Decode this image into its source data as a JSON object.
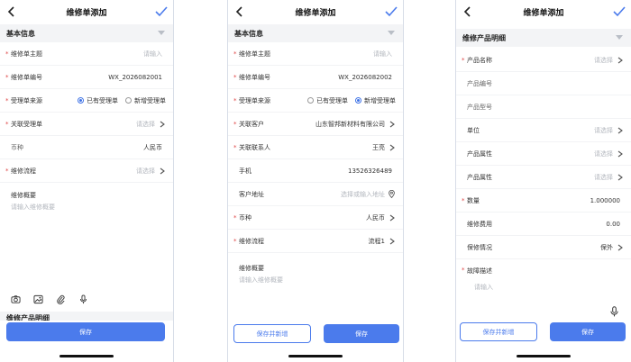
{
  "colors": {
    "primary": "#4b7bec",
    "required": "#e04848",
    "placeholder": "#b3b7be"
  },
  "screen1": {
    "title": "维修单添加",
    "section": "基本信息",
    "rows": {
      "subject": {
        "label": "维修单主题",
        "placeholder": "请输入"
      },
      "number": {
        "label": "维修单编号",
        "value": "WX_2026082001"
      },
      "source": {
        "label": "受理单来源",
        "opt1": "已有受理单",
        "opt2": "新增受理单",
        "selected": "opt1"
      },
      "linked": {
        "label": "关联受理单",
        "placeholder": "请选择"
      },
      "currency": {
        "label": "币种",
        "value": "人民币"
      },
      "flow": {
        "label": "维修流程",
        "placeholder": "请选择"
      }
    },
    "summary": {
      "label": "维修概要",
      "placeholder": "请输入维修概要"
    },
    "next_section": "维修产品明细",
    "save": "保存"
  },
  "screen2": {
    "title": "维修单添加",
    "section": "基本信息",
    "rows": {
      "subject": {
        "label": "维修单主题",
        "placeholder": "请输入"
      },
      "number": {
        "label": "维修单编号",
        "value": "WX_2026082002"
      },
      "source": {
        "label": "受理单来源",
        "opt1": "已有受理单",
        "opt2": "新增受理单",
        "selected": "opt2"
      },
      "customer": {
        "label": "关联客户",
        "value": "山东智邦新材料有限公司"
      },
      "contact": {
        "label": "关联联系人",
        "value": "王亮"
      },
      "phone": {
        "label": "手机",
        "value": "13526326489"
      },
      "address": {
        "label": "客户地址",
        "placeholder": "选择或输入地址"
      },
      "currency": {
        "label": "币种",
        "value": "人民币"
      },
      "flow": {
        "label": "维修流程",
        "value": "流程1"
      }
    },
    "summary": {
      "label": "维修概要",
      "placeholder": "请输入维修概要"
    },
    "save_new": "保存并新增",
    "save": "保存"
  },
  "screen3": {
    "title": "维修单添加",
    "section": "维修产品明细",
    "rows": {
      "product_name": {
        "label": "产品名称",
        "placeholder": "请选择"
      },
      "product_code": {
        "label": "产品编号"
      },
      "product_model": {
        "label": "产品型号"
      },
      "unit": {
        "label": "单位",
        "placeholder": "请选择"
      },
      "attr1": {
        "label": "产品属性",
        "placeholder": "请选择"
      },
      "attr2": {
        "label": "产品属性",
        "placeholder": "请选择"
      },
      "qty": {
        "label": "数量",
        "value": "1.000000"
      },
      "fee": {
        "label": "维修费用",
        "value": "0.00"
      },
      "warranty": {
        "label": "保修情况",
        "value": "保外"
      }
    },
    "fault": {
      "label": "故障描述",
      "placeholder": "请输入"
    },
    "save_new": "保存并新增",
    "save": "保存"
  }
}
